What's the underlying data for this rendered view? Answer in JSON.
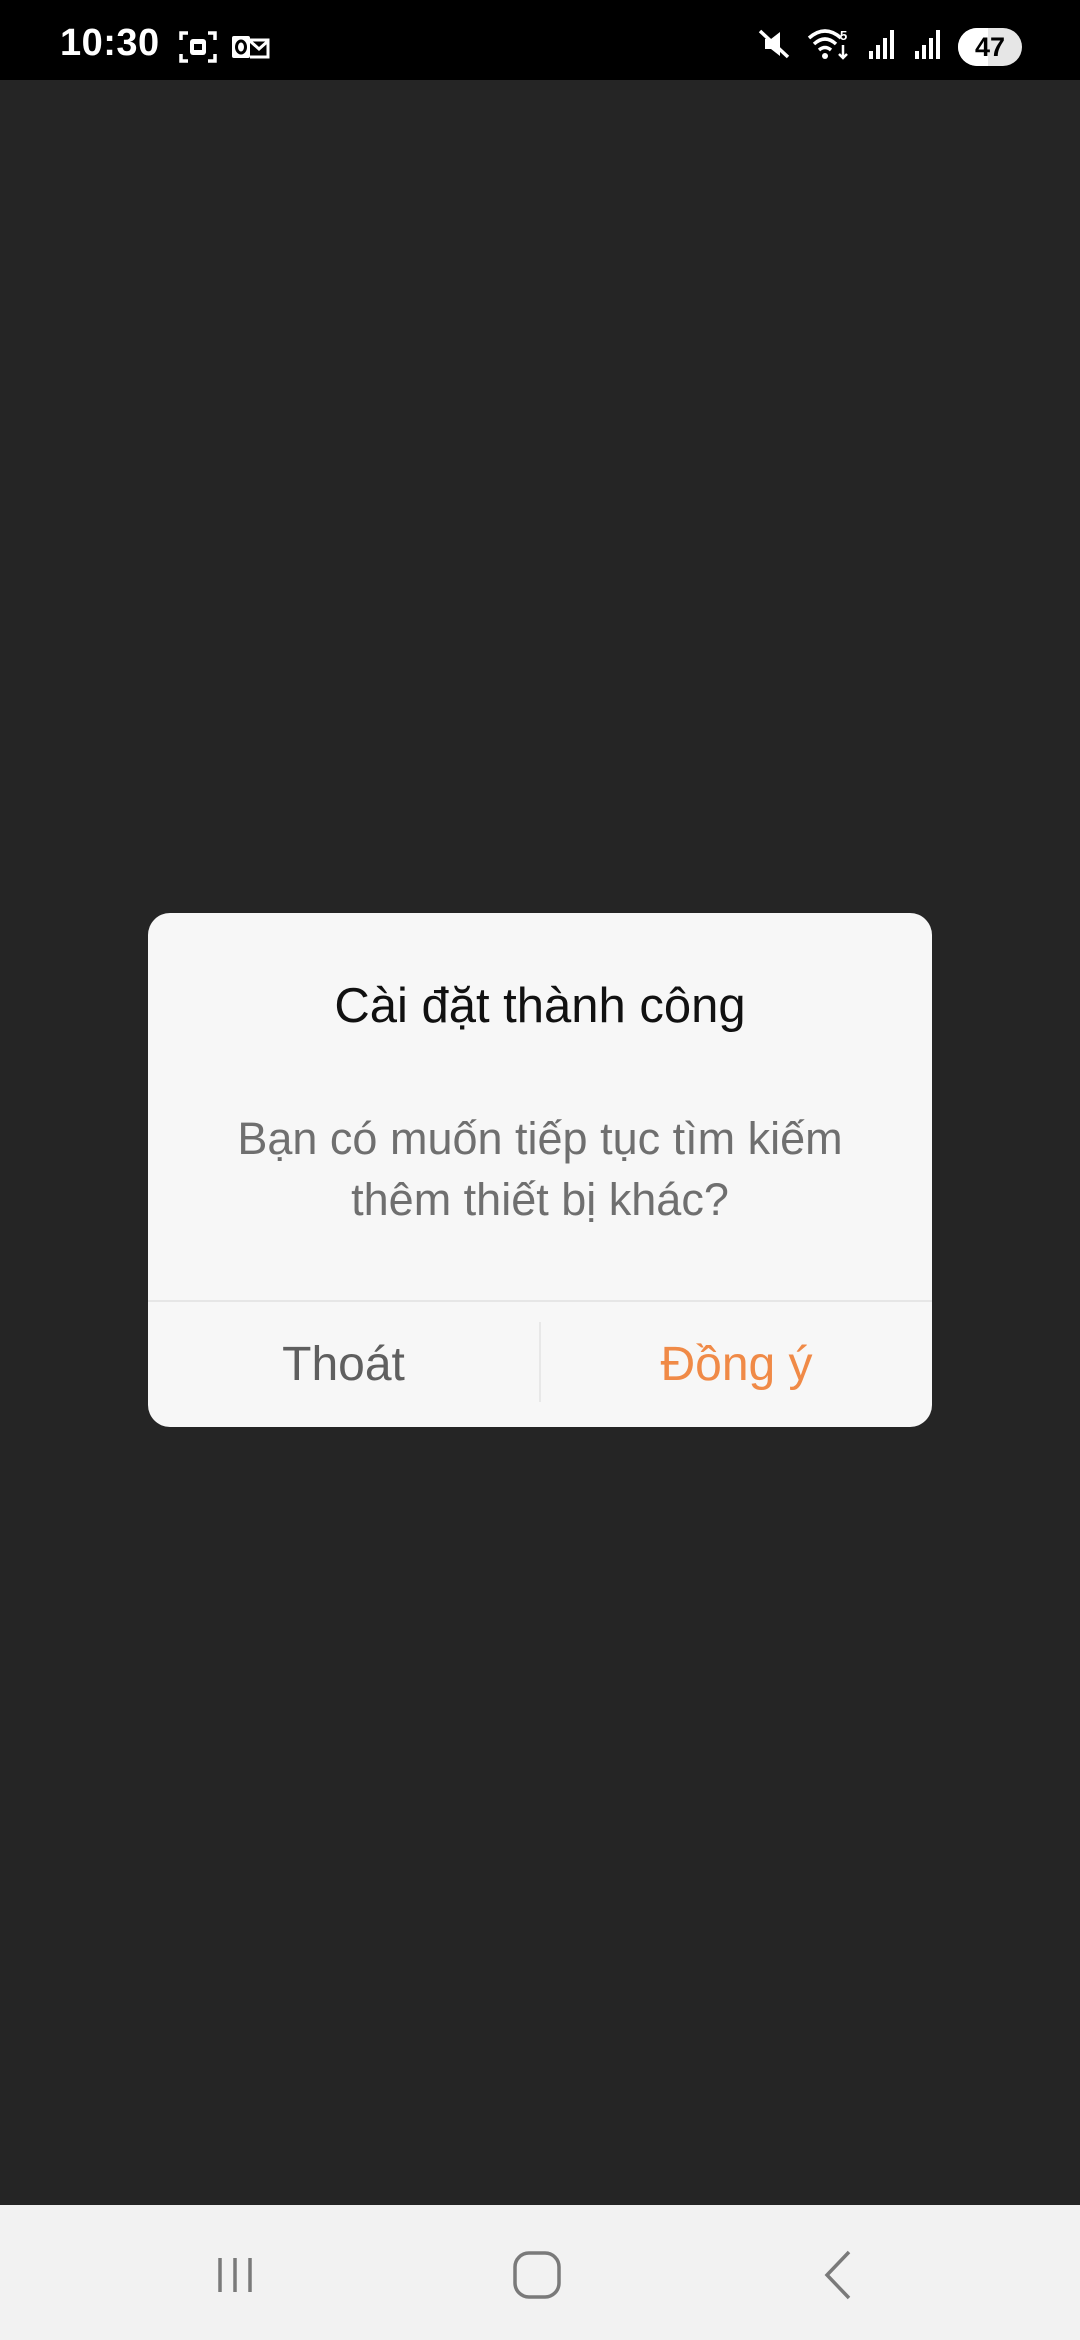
{
  "status_bar": {
    "time": "10:30",
    "battery": "47",
    "battery_level": 0.47,
    "left_icons": [
      "screenshot-icon",
      "outlook-icon"
    ],
    "right_icons": [
      "mute-icon",
      "wifi-5g-icon",
      "signal-icon",
      "signal-icon"
    ]
  },
  "dialog": {
    "title": "Cài đặt thành công",
    "message": "Bạn có muốn tiếp tục tìm kiếm thêm thiết bị khác?",
    "cancel_label": "Thoát",
    "confirm_label": "Đồng ý"
  },
  "colors": {
    "background": "#252525",
    "dialog": "#f7f7f7",
    "accent": "#f08a47",
    "cancel_text": "#5f5f5f",
    "nav_bar": "#f2f2f2"
  },
  "nav_bar": {
    "buttons": [
      "recent-apps-icon",
      "home-icon",
      "back-icon"
    ]
  }
}
